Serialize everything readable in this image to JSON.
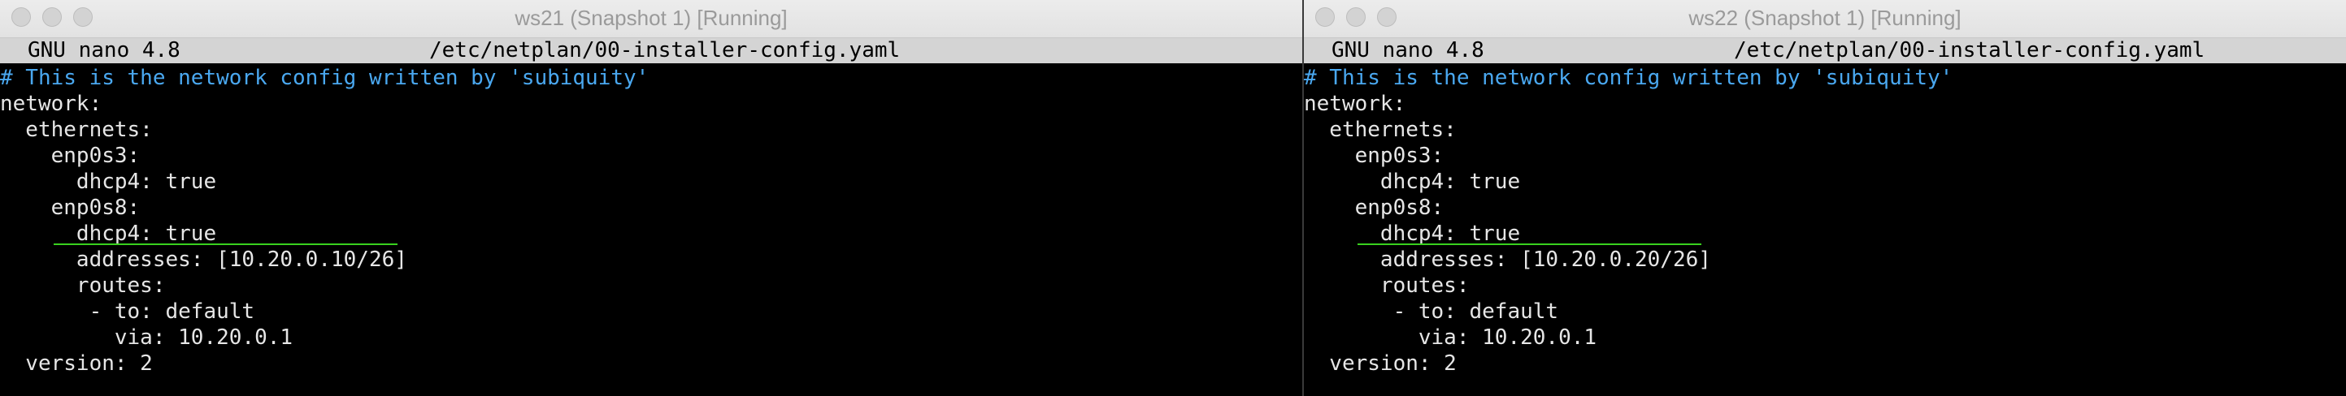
{
  "windows": [
    {
      "title": "ws21 (Snapshot 1) [Running]",
      "nano_version": "GNU nano 4.8",
      "file_path": "/etc/netplan/00-installer-config.yaml",
      "lines": [
        "# This is the network config written by 'subiquity'",
        "network:",
        "  ethernets:",
        "    enp0s3:",
        "      dhcp4: true",
        "    enp0s8:",
        "      dhcp4: true",
        "      addresses: [10.20.0.10/26]",
        "      routes:",
        "       - to: default",
        "         via: 10.20.0.1",
        "  version: 2"
      ]
    },
    {
      "title": "ws22 (Snapshot 1) [Running]",
      "nano_version": "GNU nano 4.8",
      "file_path": "/etc/netplan/00-installer-config.yaml",
      "lines": [
        "# This is the network config written by 'subiquity'",
        "network:",
        "  ethernets:",
        "    enp0s3:",
        "      dhcp4: true",
        "    enp0s8:",
        "      dhcp4: true",
        "      addresses: [10.20.0.20/26]",
        "      routes:",
        "       - to: default",
        "         via: 10.20.0.1",
        "  version: 2"
      ]
    }
  ],
  "colors": {
    "terminal_bg": "#000000",
    "terminal_text": "#e6e6e6",
    "comment": "#4aa8f0",
    "nano_header_bg": "#d4d4d4",
    "annotation_line": "#39d11e",
    "titlebar_bg": "#ececec",
    "title_text": "#9a9a9a"
  }
}
